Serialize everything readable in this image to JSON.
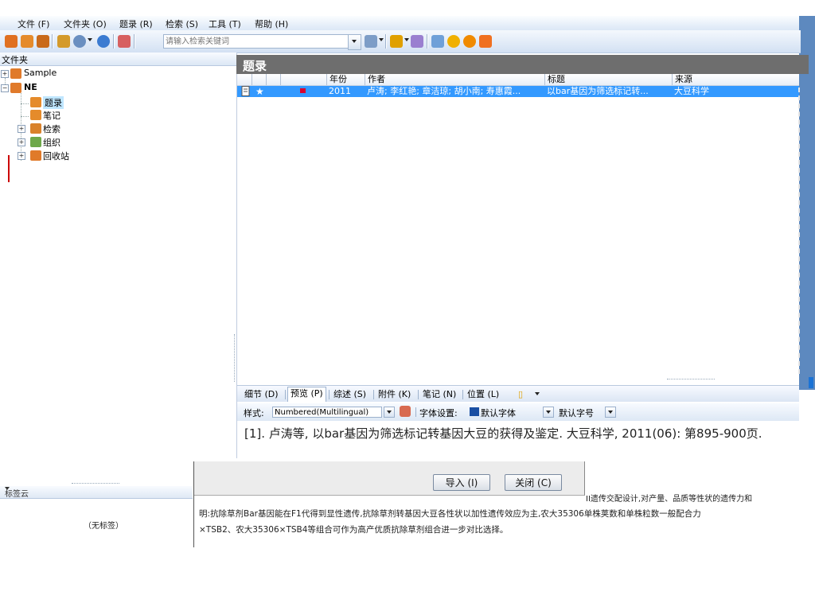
{
  "menubar": {
    "items": [
      "文件 (F)",
      "文件夹 (O)",
      "题录 (R)",
      "检索 (S)",
      "工具 (T)",
      "帮助 (H)"
    ]
  },
  "toolbar": {
    "search_placeholder": "请输入检索关键词",
    "icons": [
      "new-ref-icon",
      "edit-ref-icon",
      "delete-ref-icon",
      "import-icon",
      "export-icon",
      "web-icon",
      "search-icon",
      "scope-icon",
      "flag-icon",
      "tag-icon",
      "note-icon",
      "help-icon",
      "info-icon",
      "settings-icon"
    ]
  },
  "folders": {
    "title": "文件夹",
    "tree": [
      {
        "label": "Sample",
        "level": 0,
        "expander": "+"
      },
      {
        "label": "NE",
        "level": 0,
        "expander": "-"
      },
      {
        "label": "题录",
        "level": 1,
        "selected": true
      },
      {
        "label": "笔记",
        "level": 1
      },
      {
        "label": "检索",
        "level": 1,
        "expander": "+"
      },
      {
        "label": "组织",
        "level": 1,
        "expander": "+"
      },
      {
        "label": "回收站",
        "level": 1,
        "expander": "+"
      }
    ]
  },
  "refs": {
    "title": "题录",
    "columns": [
      "",
      "",
      "",
      "",
      "年份",
      "作者",
      "标题",
      "来源"
    ],
    "rows": [
      {
        "year": "2011",
        "authors": "卢涛; 李红艳; 章洁琼; 胡小南; 寿惠霞...",
        "title": "以bar基因为筛选标记转...",
        "source": "大豆科学"
      }
    ]
  },
  "detail_tabs": [
    "细节 (D)",
    "预览 (P)",
    "综述 (S)",
    "附件 (K)",
    "笔记 (N)",
    "位置 (L)"
  ],
  "detail_active": "预览 (P)",
  "stylebar": {
    "style_label": "样式:",
    "style_value": "Numbered(Multilingual)",
    "font_label": "字体设置:",
    "font_value": "默认字体",
    "size_value": "默认字号"
  },
  "citation": "[1].   卢涛等, 以bar基因为筛选标记转基因大豆的获得及鉴定. 大豆科学, 2011(06): 第895-900页.",
  "tagcloud": {
    "title": "标签云",
    "empty": "（无标签）"
  },
  "dialog": {
    "import_label": "导入 (I)",
    "close_label": "关闭 (C)"
  },
  "abstract": {
    "line1": "II遗传交配设计,对产量、品质等性状的遗传力和",
    "line2": "明:抗除草剂Bar基因能在F1代得到显性遗传,抗除草剂转基因大豆各性状以加性遗传效应为主,农大35306单株荚数和单株粒数一般配合力",
    "line3": "×TSB2、农大35306×TSB4等组合可作为高产优质抗除草剂组合进一步对比选择。"
  },
  "colors": {
    "selection": "#3399ff",
    "title_band": "#6e6e6e",
    "toolbar": "#d3e1f3"
  }
}
